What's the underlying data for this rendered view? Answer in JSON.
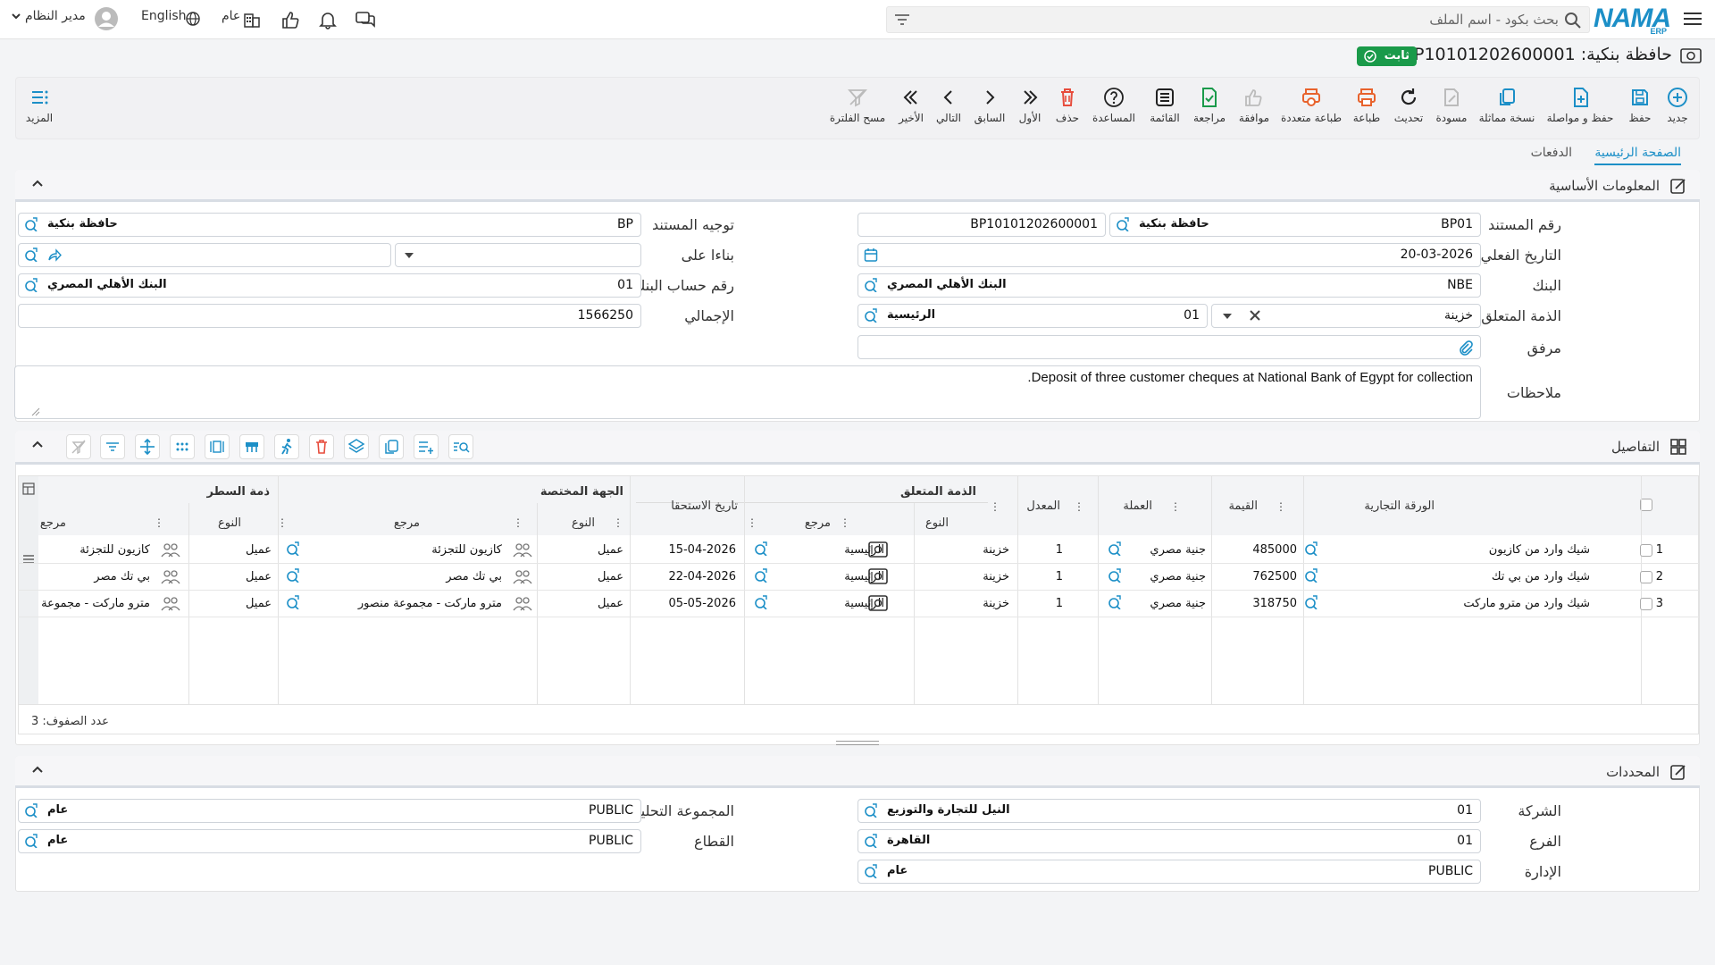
{
  "topbar": {
    "search_placeholder": "بحث بكود - اسم الملف",
    "logo": "NAMA",
    "logo_sub": "ERP",
    "user": "مدير النظام",
    "language": "English",
    "scope": "عام"
  },
  "header": {
    "title": "حافظة بنكية: BP10101202600001",
    "status": "ثابت"
  },
  "toolbar": {
    "new": "جديد",
    "save": "حفظ",
    "save_continue": "حفظ و مواصلة",
    "duplicate": "نسخة مماثلة",
    "draft": "مسودة",
    "refresh": "تحديث",
    "print": "طباعة",
    "multi_print": "طباعة متعددة",
    "approve": "موافقة",
    "review": "مراجعة",
    "list": "القائمة",
    "help": "المساعدة",
    "delete": "حذف",
    "first": "الأول",
    "previous": "السابق",
    "next": "التالي",
    "last": "الأخير",
    "clear_filter": "مسح الفلترة",
    "more": "المزيد"
  },
  "tabs": {
    "main": "الصفحة الرئيسية",
    "payments": "الدفعات"
  },
  "basic_info": {
    "title": "المعلومات الأساسية",
    "doc_no_label": "رقم المستند",
    "doc_no_code": "BP01",
    "doc_no_name": "حافظة بنكية",
    "doc_no_full": "BP10101202600001",
    "direction_label": "توجيه المستند",
    "direction_code": "BP",
    "direction_name": "حافظة بنكية",
    "actual_date_label": "التاريخ الفعلي",
    "actual_date": "20-03-2026",
    "based_on_label": "بناءا على",
    "bank_label": "البنك",
    "bank_code": "NBE",
    "bank_name": "البنك الأهلي المصري",
    "bank_account_label": "رقم حساب البنك",
    "bank_account_code": "01",
    "bank_account_name": "البنك الأهلي المصري",
    "related_label": "الذمة المتعلق",
    "related_type": "خزينة",
    "related_code": "01",
    "related_name": "الرئيسية",
    "total_label": "الإجمالي",
    "total": "1566250",
    "attachment_label": "مرفق",
    "notes_label": "ملاحظات",
    "notes": "Deposit of three customer cheques at National Bank of Egypt for collection."
  },
  "details": {
    "title": "التفاصيل",
    "group_related": "الذمة المتعلق",
    "group_party": "الجهة المختصة",
    "group_line": "ذمة السطر",
    "col_paper": "الورقة التجارية",
    "col_value": "القيمة",
    "col_currency": "العملة",
    "col_rate": "المعدل",
    "col_type": "النوع",
    "col_ref": "مرجع",
    "col_due": "تاريخ الاستحقا",
    "rows": [
      {
        "n": "1",
        "paper": "شيك وارد من كازيون",
        "value": "485000",
        "currency": "جنية مصري",
        "rate": "1",
        "rtype": "خزينة",
        "rref": "الرئيسية",
        "due": "15-04-2026",
        "ptype": "عميل",
        "pref": "كازيون للتجزئة",
        "ltype": "عميل",
        "lref": "كازيون للتجزئة"
      },
      {
        "n": "2",
        "paper": "شيك وارد من بي تك",
        "value": "762500",
        "currency": "جنية مصري",
        "rate": "1",
        "rtype": "خزينة",
        "rref": "الرئيسية",
        "due": "22-04-2026",
        "ptype": "عميل",
        "pref": "بي تك مصر",
        "ltype": "عميل",
        "lref": "بي تك مصر"
      },
      {
        "n": "3",
        "paper": "شيك وارد من مترو ماركت",
        "value": "318750",
        "currency": "جنية مصري",
        "rate": "1",
        "rtype": "خزينة",
        "rref": "الرئيسية",
        "due": "05-05-2026",
        "ptype": "عميل",
        "pref": "مترو ماركت - مجموعة منصور",
        "ltype": "عميل",
        "lref": "مترو ماركت - مجموعة"
      }
    ],
    "row_count": "عدد الصفوف: 3"
  },
  "dimensions": {
    "title": "المحددات",
    "company_label": "الشركة",
    "company_code": "01",
    "company_name": "النيل للتجارة والتوزيع",
    "analytic_label": "المجموعة التحليلية",
    "analytic_code": "PUBLIC",
    "analytic_name": "عام",
    "branch_label": "الفرع",
    "branch_code": "01",
    "branch_name": "القاهرة",
    "sector_label": "القطاع",
    "sector_code": "PUBLIC",
    "sector_name": "عام",
    "dept_label": "الإدارة",
    "dept_code": "PUBLIC",
    "dept_name": "عام"
  },
  "colors": {
    "accent": "#1c8fc7",
    "status_green": "#1a9a4a",
    "danger": "#e74c3c",
    "orange": "#e8622c"
  }
}
